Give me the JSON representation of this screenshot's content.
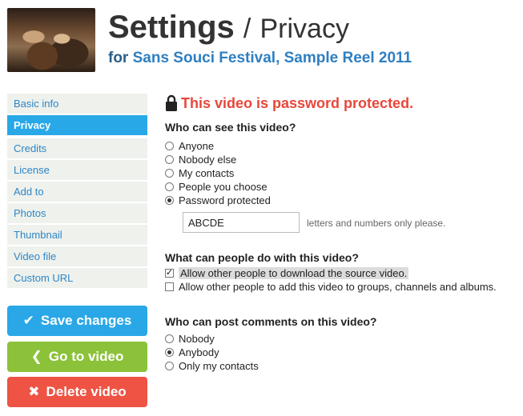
{
  "header": {
    "title": "Settings",
    "separator": "/",
    "section": "Privacy",
    "for_prefix": "for",
    "video_title": "Sans Souci Festival, Sample Reel 2011"
  },
  "sidebar": {
    "items": [
      {
        "label": "Basic info"
      },
      {
        "label": "Privacy"
      },
      {
        "label": "Credits"
      },
      {
        "label": "License"
      },
      {
        "label": "Add to"
      },
      {
        "label": "Photos"
      },
      {
        "label": "Thumbnail"
      },
      {
        "label": "Video file"
      },
      {
        "label": "Custom URL"
      }
    ],
    "active_index": 1
  },
  "buttons": {
    "save": {
      "label": "Save changes",
      "icon": "checkmark-icon"
    },
    "go": {
      "label": "Go to video",
      "icon": "chevron-left-icon"
    },
    "delete": {
      "label": "Delete video",
      "icon": "x-icon"
    }
  },
  "warning": {
    "text": "This video is password protected.",
    "icon": "lock-icon"
  },
  "who_can_see": {
    "heading": "Who can see this video?",
    "options": [
      "Anyone",
      "Nobody else",
      "My contacts",
      "People you choose",
      "Password protected"
    ],
    "selected_index": 4,
    "password_value": "ABCDE",
    "password_hint": "letters and numbers only please."
  },
  "what_can_do": {
    "heading": "What can people do with this video?",
    "options": [
      {
        "label": "Allow other people to download the source video.",
        "checked": true
      },
      {
        "label": "Allow other people to add this video to groups, channels and albums.",
        "checked": false
      }
    ]
  },
  "comments": {
    "heading": "Who can post comments on this video?",
    "options": [
      "Nobody",
      "Anybody",
      "Only my contacts"
    ],
    "selected_index": 1
  },
  "colors": {
    "accent_blue": "#29a8e8",
    "green": "#8cc23a",
    "red": "#ee5343",
    "warning_red": "#e7473b"
  }
}
